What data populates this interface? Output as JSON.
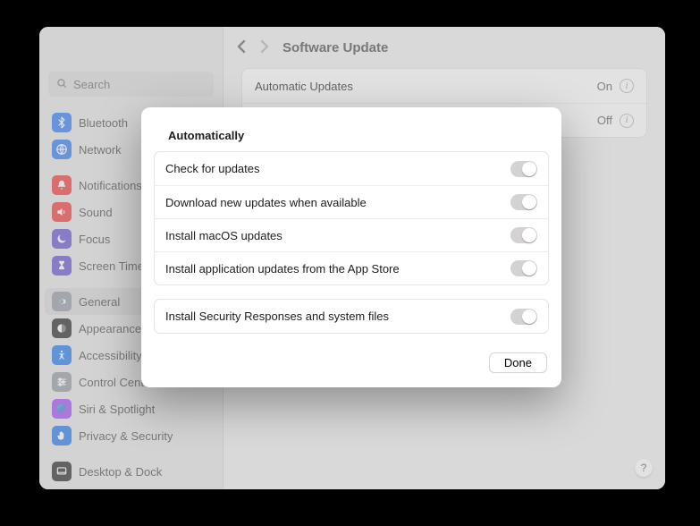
{
  "search": {
    "placeholder": "Search"
  },
  "sidebar": {
    "items": [
      {
        "label": "Bluetooth",
        "color": "#3b82f6",
        "icon": "bluetooth"
      },
      {
        "label": "Network",
        "color": "#3b82f6",
        "icon": "globe"
      },
      {
        "label": "Notifications",
        "color": "#ef4444",
        "icon": "bell",
        "gapBefore": true
      },
      {
        "label": "Sound",
        "color": "#ef4444",
        "icon": "speaker"
      },
      {
        "label": "Focus",
        "color": "#6d5bd0",
        "icon": "moon"
      },
      {
        "label": "Screen Time",
        "color": "#6d5bd0",
        "icon": "hourglass"
      },
      {
        "label": "General",
        "color": "#9aa0a6",
        "icon": "gear",
        "gapBefore": true,
        "selected": true
      },
      {
        "label": "Appearance",
        "color": "#333333",
        "icon": "appearance"
      },
      {
        "label": "Accessibility",
        "color": "#2f80ed",
        "icon": "accessibility"
      },
      {
        "label": "Control Center",
        "color": "#9aa0a6",
        "icon": "sliders"
      },
      {
        "label": "Siri & Spotlight",
        "color": "#a855f7",
        "icon": "siri"
      },
      {
        "label": "Privacy & Security",
        "color": "#2f80ed",
        "icon": "hand"
      },
      {
        "label": "Desktop & Dock",
        "color": "#333333",
        "icon": "dock",
        "gapBefore": true
      }
    ]
  },
  "header": {
    "title": "Software Update"
  },
  "rows": [
    {
      "label": "Automatic Updates",
      "value": "On"
    },
    {
      "label": "",
      "value": "Off"
    }
  ],
  "sheet": {
    "title": "Automatically",
    "group1": [
      {
        "label": "Check for updates",
        "on": true
      },
      {
        "label": "Download new updates when available",
        "on": true
      },
      {
        "label": "Install macOS updates",
        "on": true
      },
      {
        "label": "Install application updates from the App Store",
        "on": true
      }
    ],
    "group2": [
      {
        "label": "Install Security Responses and system files",
        "on": true
      }
    ],
    "doneLabel": "Done"
  },
  "help": "?"
}
